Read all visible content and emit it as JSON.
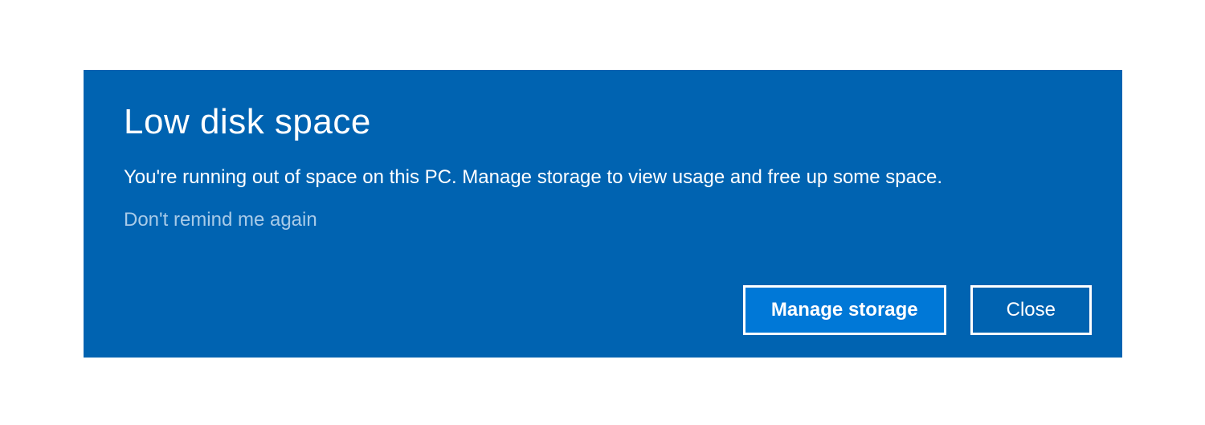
{
  "dialog": {
    "title": "Low disk space",
    "message": "You're running out of space on this PC. Manage storage to view usage and free up some space.",
    "link": "Don't remind me again",
    "buttons": {
      "primary": "Manage storage",
      "secondary": "Close"
    }
  }
}
